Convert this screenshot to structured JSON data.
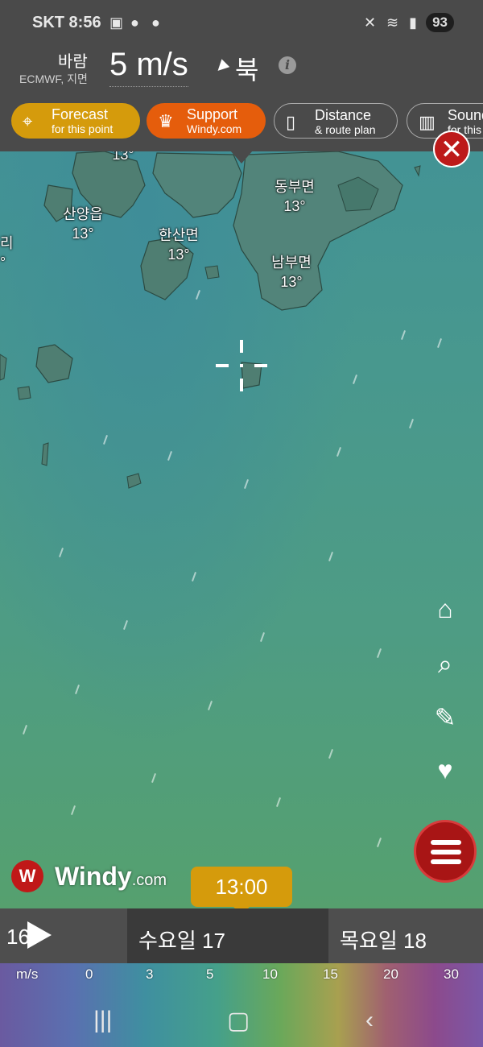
{
  "status": {
    "time": "SKT 8:56",
    "battery": "93"
  },
  "header": {
    "layer_name": "바람",
    "layer_source": "ECMWF, 지면",
    "wind_value": "5 m/s",
    "wind_direction": "북"
  },
  "buttons": {
    "forecast": {
      "line1": "Forecast",
      "line2": "for this point"
    },
    "support": {
      "line1": "Support",
      "line2": "Windy.com"
    },
    "distance": {
      "line1": "Distance",
      "line2": "& route plan"
    },
    "sounding": {
      "line1": "Sounding",
      "line2": "for this point"
    }
  },
  "map_labels": [
    {
      "name": "",
      "temp": "13°"
    },
    {
      "name": "산양읍",
      "temp": "13°"
    },
    {
      "name": "한산면",
      "temp": "13°"
    },
    {
      "name": "동부면",
      "temp": "13°"
    },
    {
      "name": "남부면",
      "temp": "13°"
    },
    {
      "name": "리",
      "temp": "°"
    }
  ],
  "logo": {
    "name": "Windy",
    "domain": ".com"
  },
  "time_bubble": "13:00",
  "timeline": {
    "prev_day": "16",
    "selected_day": "수요일 17",
    "next_day": "목요일 18"
  },
  "legend": {
    "unit": "m/s",
    "values": [
      "0",
      "3",
      "5",
      "10",
      "15",
      "20",
      "30"
    ]
  }
}
